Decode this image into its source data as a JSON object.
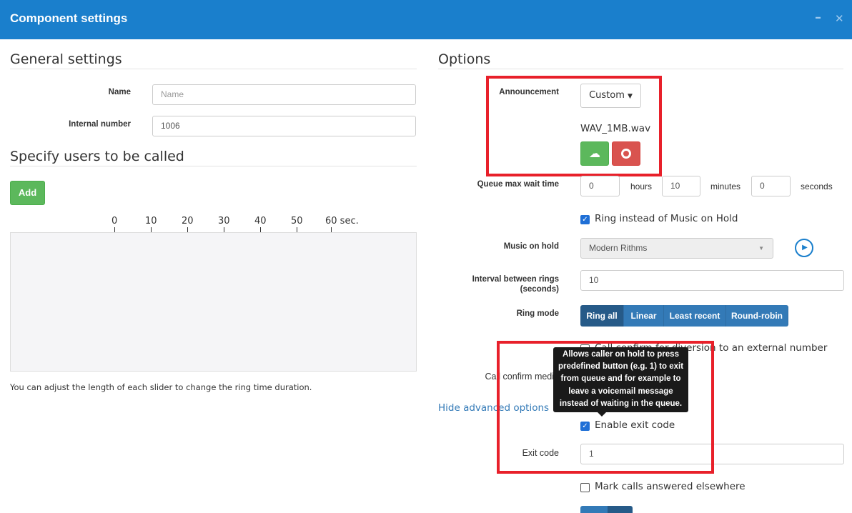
{
  "window": {
    "title": "Component settings",
    "minimize_icon": "minimize-icon",
    "close_icon": "close-icon",
    "minimize_glyph": "–",
    "close_glyph": "✕"
  },
  "general": {
    "heading": "General settings",
    "name_label": "Name",
    "name_value": "",
    "name_placeholder": "Name",
    "internal_label": "Internal number",
    "internal_value": "1006"
  },
  "users": {
    "heading": "Specify users to be called",
    "add_label": "Add",
    "ticks": [
      "0",
      "10",
      "20",
      "30",
      "40",
      "50",
      "60 sec."
    ],
    "help": "You can adjust the length of each slider to change the ring time duration."
  },
  "options": {
    "heading": "Options",
    "announcement_label": "Announcement",
    "announcement_value": "Custom",
    "file_name": "WAV_1MB.wav",
    "upload_icon": "cloud-upload-icon",
    "record_icon": "record-icon",
    "queue_label": "Queue max wait time",
    "hours": "0",
    "hours_unit": "hours",
    "minutes": "10",
    "minutes_unit": "minutes",
    "seconds": "0",
    "seconds_unit": "seconds",
    "ring_instead_label": "Ring instead of Music on Hold",
    "ring_instead_checked": true,
    "moh_label": "Music on hold",
    "moh_value": "Modern Rithms",
    "play_icon": "play-icon",
    "interval_label_1": "Interval between rings",
    "interval_label_2": "(seconds)",
    "interval_value": "10",
    "ring_mode_label": "Ring mode",
    "ring_modes": [
      "Ring all",
      "Linear",
      "Least recent",
      "Round-robin"
    ],
    "ring_mode_selected": "Ring all",
    "call_confirm_label": "Call confirm for diversion to an external number",
    "call_confirm_checked": false,
    "call_confirm_media_label": "Call confirm media",
    "tooltip": "Allows caller on hold to press predefined button (e.g. 1) to exit from queue and for example to leave a voicemail message instead of waiting in the queue.",
    "hide_advanced": "Hide advanced options",
    "exit_enable_label": "Enable exit code",
    "exit_enable_checked": true,
    "exit_code_label": "Exit code",
    "exit_code_value": "1",
    "mark_calls_label": "Mark calls answered elsewhere",
    "mark_calls_checked": false
  },
  "colors": {
    "header": "#1a7fcc",
    "highlight": "#e8202a",
    "primary": "#337ab7",
    "success": "#5cb85c",
    "danger": "#d9534f"
  }
}
